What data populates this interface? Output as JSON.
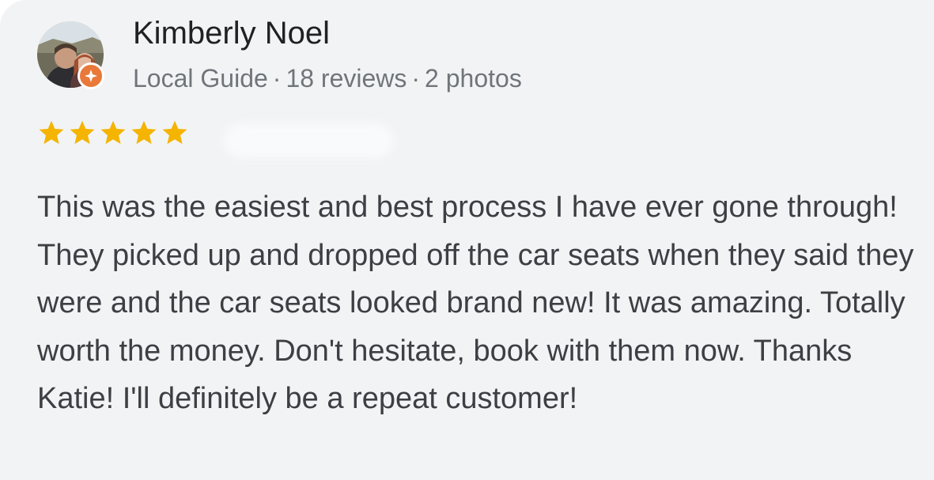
{
  "review": {
    "author_name": "Kimberly Noel",
    "author_role": "Local Guide",
    "review_count": "18 reviews",
    "photo_count": "2 photos",
    "meta_separator": "·",
    "rating": 5,
    "rating_max": 5,
    "star_color": "#f4b400",
    "badge_color": "#e8793a",
    "text": "This was the easiest and best process I have ever gone through! They picked up and dropped off the car seats when they said they were and the car seats looked brand new! It was amazing. Totally worth the money. Don't hesitate, book with them now. Thanks Katie! I'll definitely be a repeat customer!"
  }
}
